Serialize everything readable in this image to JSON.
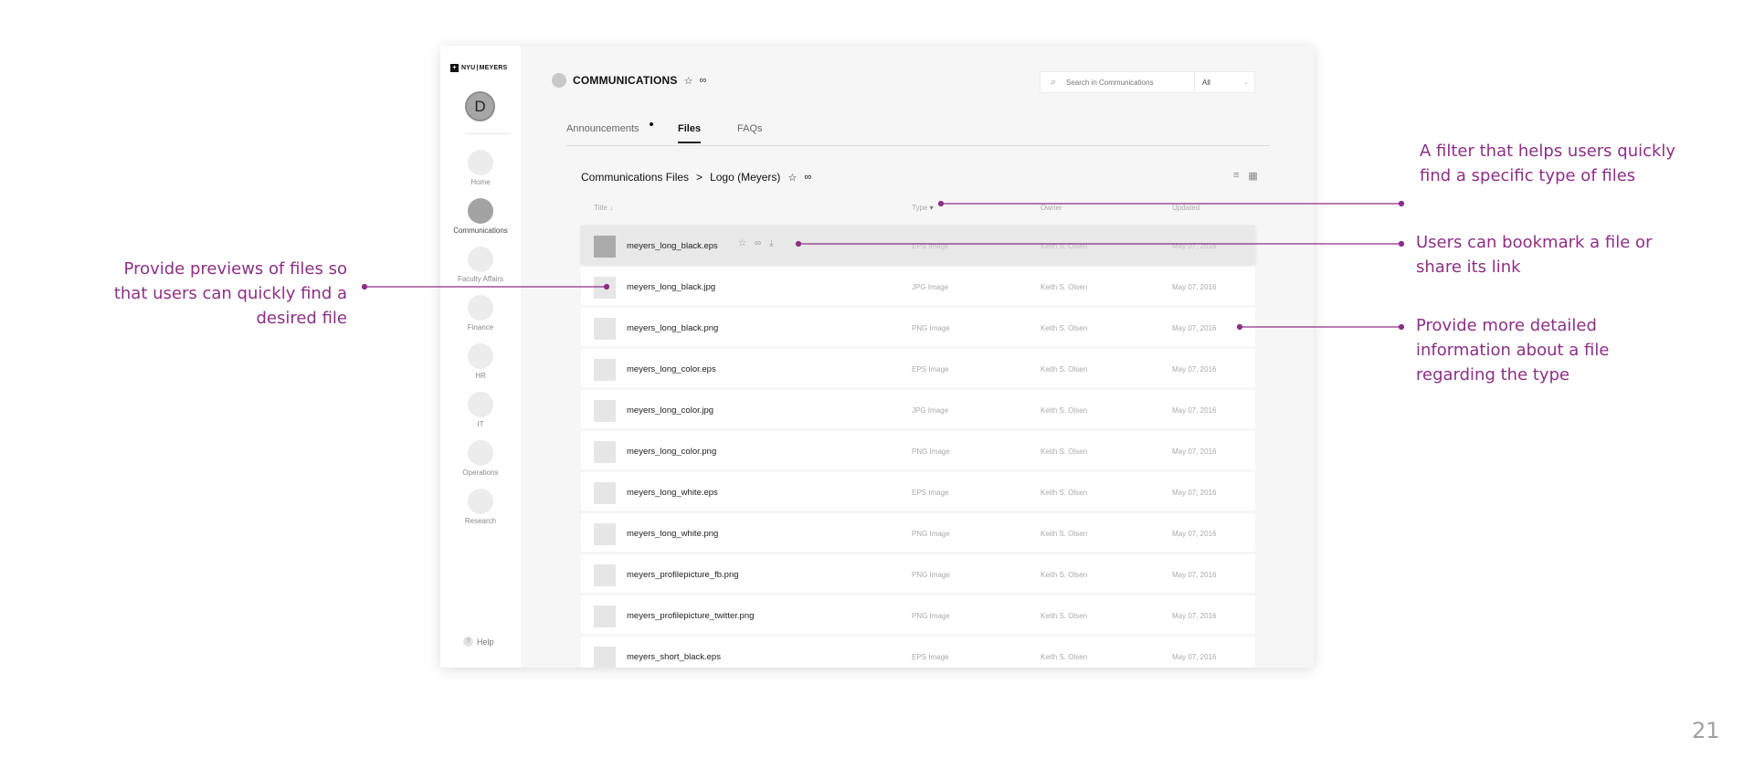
{
  "app": {
    "logo": {
      "mark": "+",
      "left": "NYU",
      "right": "MEYERS"
    },
    "user_initial": "D",
    "nav": [
      {
        "label": "Home",
        "active": false
      },
      {
        "label": "Communications",
        "active": true
      },
      {
        "label": "Faculty Affairs",
        "active": false
      },
      {
        "label": "Finance",
        "active": false
      },
      {
        "label": "HR",
        "active": false
      },
      {
        "label": "IT",
        "active": false
      },
      {
        "label": "Operations",
        "active": false
      },
      {
        "label": "Research",
        "active": false
      }
    ],
    "help": {
      "icon": "?",
      "label": "Help"
    },
    "header": {
      "title": "COMMUNICATIONS",
      "star_icon": "☆",
      "link_icon": "∞"
    },
    "search": {
      "icon": "⌕",
      "placeholder": "Search in Communications",
      "filter_value": "All",
      "chevron": "⌄"
    },
    "tabs": [
      {
        "label": "Announcements",
        "active": false,
        "has_dot": true
      },
      {
        "label": "Files",
        "active": true
      },
      {
        "label": "FAQs",
        "active": false
      }
    ],
    "breadcrumb": {
      "root": "Communications Files",
      "separator": ">",
      "current": "Logo (Meyers)"
    },
    "view_icons": {
      "sort": "≡",
      "grid": "▦"
    },
    "columns": {
      "title": "Title",
      "title_sort": "↓",
      "type": "Type",
      "type_filter": "▾",
      "owner": "Owner",
      "updated": "Updated"
    },
    "row_actions": {
      "star": "☆",
      "link": "∞",
      "download": "⤓"
    },
    "files": [
      {
        "name": "meyers_long_black.eps",
        "type": "EPS Image",
        "owner": "Keith S. Olsen",
        "updated": "May 07, 2016",
        "selected": true
      },
      {
        "name": "meyers_long_black.jpg",
        "type": "JPG Image",
        "owner": "Keith S. Olsen",
        "updated": "May 07, 2016"
      },
      {
        "name": "meyers_long_black.png",
        "type": "PNG Image",
        "owner": "Keith S. Olsen",
        "updated": "May 07, 2016"
      },
      {
        "name": "meyers_long_color.eps",
        "type": "EPS Image",
        "owner": "Keith S. Olsen",
        "updated": "May 07, 2016"
      },
      {
        "name": "meyers_long_color.jpg",
        "type": "JPG Image",
        "owner": "Keith S. Olsen",
        "updated": "May 07, 2016"
      },
      {
        "name": "meyers_long_color.png",
        "type": "PNG Image",
        "owner": "Keith S. Olsen",
        "updated": "May 07, 2016"
      },
      {
        "name": "meyers_long_white.eps",
        "type": "EPS Image",
        "owner": "Keith S. Olsen",
        "updated": "May 07, 2016"
      },
      {
        "name": "meyers_long_white.png",
        "type": "PNG Image",
        "owner": "Keith S. Olsen",
        "updated": "May 07, 2016"
      },
      {
        "name": "meyers_profilepicture_fb.png",
        "type": "PNG Image",
        "owner": "Keith S. Olsen",
        "updated": "May 07, 2016"
      },
      {
        "name": "meyers_profilepicture_twitter.png",
        "type": "PNG Image",
        "owner": "Keith S. Olsen",
        "updated": "May 07, 2016"
      },
      {
        "name": "meyers_short_black.eps",
        "type": "EPS Image",
        "owner": "Keith S. Olsen",
        "updated": "May 07, 2016"
      }
    ]
  },
  "annotations": {
    "previews": "Provide previews of files so that users can quickly find a desired file",
    "filter": "A filter that helps users quickly find a specific type of files",
    "bookmark": "Users can bookmark a file or share its link",
    "details": "Provide more detailed information about a file regarding the type"
  },
  "colors": {
    "annotation": "#8d2f86"
  },
  "page_number": "21"
}
